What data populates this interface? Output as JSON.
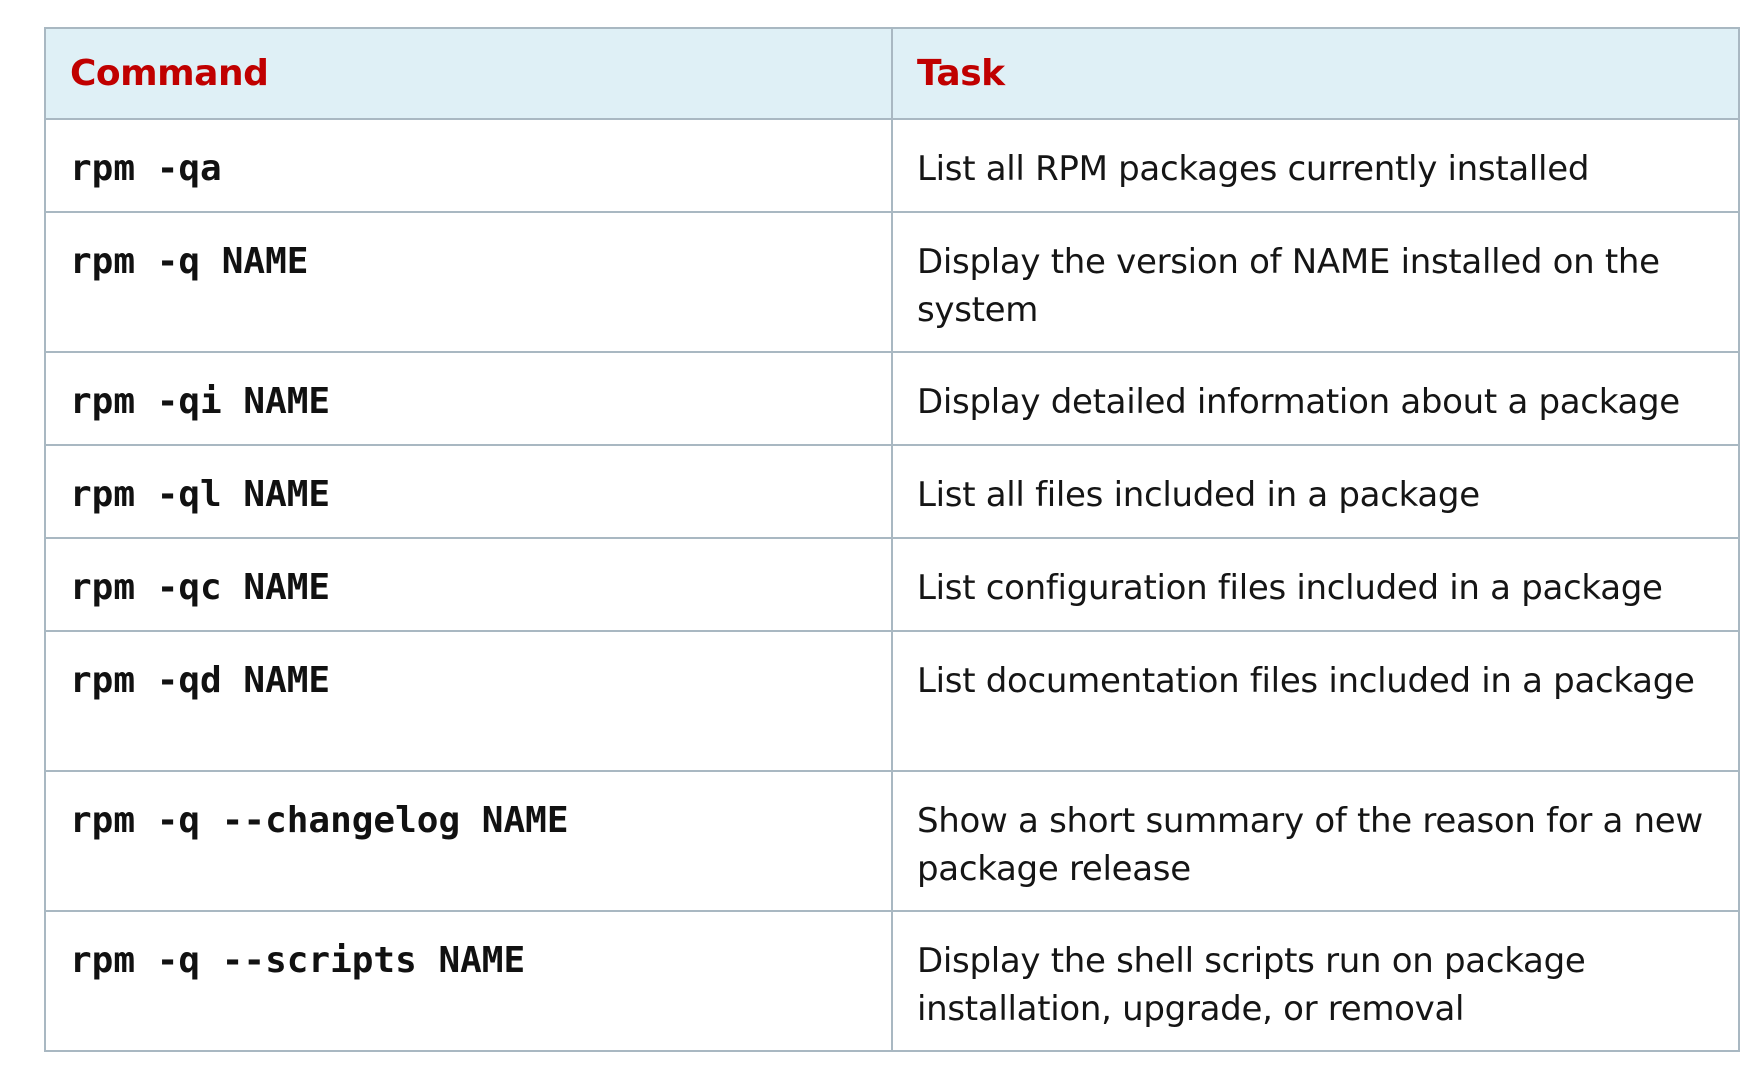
{
  "table": {
    "headers": [
      "Command",
      "Task"
    ],
    "rows": [
      {
        "command": "rpm -qa",
        "task": "List all RPM packages currently installed"
      },
      {
        "command": "rpm -q NAME",
        "task": "Display the version of NAME installed on the system"
      },
      {
        "command": "rpm -qi NAME",
        "task": "Display detailed information about a package"
      },
      {
        "command": "rpm -ql NAME",
        "task": "List all files included in a package"
      },
      {
        "command": "rpm -qc NAME",
        "task": "List configuration files included in a package"
      },
      {
        "command": "rpm -qd NAME",
        "task": "List documentation files included in a package"
      },
      {
        "command": "rpm -q --changelog NAME",
        "task": "Show a short summary of the reason for a new package release"
      },
      {
        "command": "rpm -q --scripts NAME",
        "task": "Display the shell scripts run on package installation, upgrade, or removal"
      }
    ]
  },
  "colors": {
    "header_bg": "#dff0f6",
    "header_text": "#c00000",
    "border": "#a9b8c2"
  }
}
